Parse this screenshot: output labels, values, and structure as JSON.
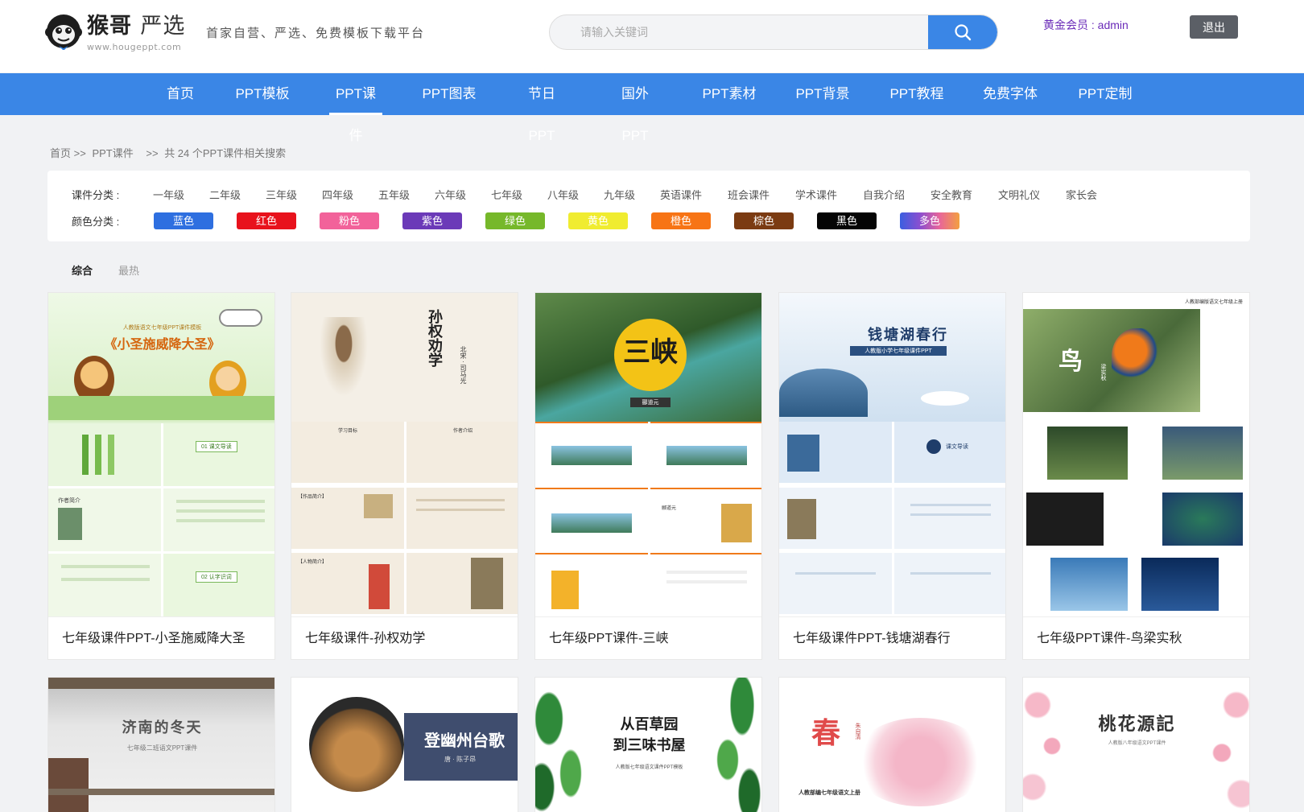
{
  "brand": {
    "name": "猴哥",
    "name_suffix": "严选",
    "url": "www.hougeppt.com",
    "slogan": "首家自营、严选、免费模板下载平台"
  },
  "search": {
    "placeholder": "请输入关键词",
    "button_icon": "search-icon"
  },
  "user": {
    "member_text": "黄金会员 : admin",
    "logout_label": "退出"
  },
  "nav": {
    "items": [
      "首页",
      "PPT模板",
      "PPT课件",
      "PPT图表",
      "节日PPT",
      "国外PPT",
      "PPT素材",
      "PPT背景",
      "PPT教程",
      "免费字体",
      "PPT定制"
    ],
    "active": "PPT课件"
  },
  "breadcrumb": {
    "home": "首页",
    "sep1": ">>",
    "section": "PPT课件",
    "sep2": ">>",
    "summary": "共 24 个PPT课件相关搜索"
  },
  "filters": {
    "category_label": "课件分类 :",
    "categories": [
      "一年级",
      "二年级",
      "三年级",
      "四年级",
      "五年级",
      "六年级",
      "七年级",
      "八年级",
      "九年级",
      "英语课件",
      "班会课件",
      "学术课件",
      "自我介绍",
      "安全教育",
      "文明礼仪",
      "家长会"
    ],
    "color_label": "颜色分类 :",
    "colors": [
      {
        "label": "蓝色",
        "hex": "#2e6fe0"
      },
      {
        "label": "红色",
        "hex": "#e8121c"
      },
      {
        "label": "粉色",
        "hex": "#f2629a"
      },
      {
        "label": "紫色",
        "hex": "#6b3ab8"
      },
      {
        "label": "绿色",
        "hex": "#76b82a"
      },
      {
        "label": "黄色",
        "hex": "#f0ec30"
      },
      {
        "label": "橙色",
        "hex": "#f77415"
      },
      {
        "label": "棕色",
        "hex": "#7b3b12"
      },
      {
        "label": "黑色",
        "hex": "#050505"
      },
      {
        "label": "多色",
        "hex": "multicolor"
      }
    ]
  },
  "sort": {
    "options": [
      "综合",
      "最热"
    ],
    "active": "综合"
  },
  "cards": [
    {
      "title": "七年级课件PPT-小圣施威降大圣",
      "cover_top_text": "人教版语文七年级PPT课件模板",
      "cover_title": "《小圣施威降大圣》",
      "slide_labels": [
        "01 课文导读",
        "作者简介",
        "02 认字识词"
      ]
    },
    {
      "title": "七年级课件-孙权劝学",
      "cover_title": "孙权劝学",
      "cover_author": "北宋 · 司马光",
      "slide_labels": [
        "学习目标",
        "作者介绍",
        "【作品简介】",
        "【人物简介】"
      ]
    },
    {
      "title": "七年级PPT课件-三峡",
      "cover_title": "三峡",
      "cover_author": "郦道元",
      "slide_labels": [
        "郦道元"
      ]
    },
    {
      "title": "七年级课件PPT-钱塘湖春行",
      "cover_title": "钱塘湖春行",
      "cover_sub": "人教版小学七年级课件PPT",
      "slide_labels": [
        "课文导读"
      ]
    },
    {
      "title": "七年级PPT课件-鸟梁实秋",
      "cover_top_text": "人教部编版语文七年级上册",
      "cover_title": "鸟",
      "cover_author": "梁实秋"
    },
    {
      "cover_title": "济南的冬天",
      "cover_sub": "七年级二班语文PPT课件"
    },
    {
      "cover_title": "登幽州台歌",
      "cover_author": "唐 · 陈子昂"
    },
    {
      "cover_title_line1": "从百草园",
      "cover_title_line2": "到三味书屋",
      "cover_sub": "人教版七年级语文课件PPT模板"
    },
    {
      "cover_title": "春",
      "cover_author": "朱自清",
      "cover_sub": "人教部编七年级语文上册"
    },
    {
      "cover_title": "桃花源記",
      "cover_sub": "人教版八年级语文PPT课件"
    }
  ]
}
